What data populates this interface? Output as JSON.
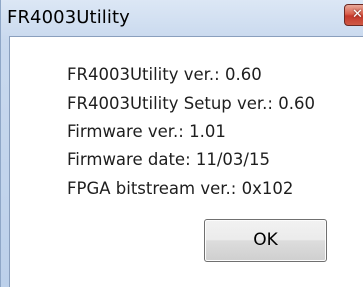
{
  "window": {
    "title": "FR4003Utility",
    "close_glyph": "✕"
  },
  "info": {
    "lines": [
      "FR4003Utility ver.: 0.60",
      "FR4003Utility Setup ver.: 0.60",
      "Firmware ver.: 1.01",
      "Firmware date: 11/03/15",
      "FPGA bitstream ver.: 0x102"
    ]
  },
  "buttons": {
    "ok_label": "OK"
  },
  "colors": {
    "close_button": "#c4382b",
    "title_bar": "#c9d9ee"
  }
}
